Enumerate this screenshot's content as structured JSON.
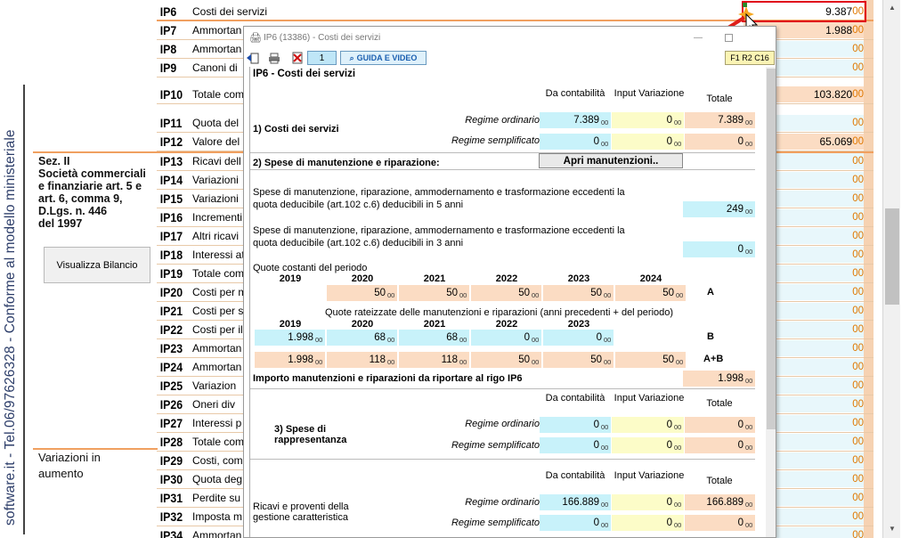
{
  "left_panel": {
    "vertical_text": "software.it - Tel.06/97626328 - Conforme al modello ministeriale",
    "sez_lines": [
      "Sez. II",
      "Società commerciali",
      "e finanziarie art. 5 e",
      "art. 6, comma 9,",
      "D.Lgs. n. 446",
      "del 1997"
    ],
    "visualizza_button": "Visualizza Bilancio",
    "variazioni_lines": [
      "Variazioni in",
      "aumento"
    ]
  },
  "rows": [
    {
      "code": "IP6",
      "desc": "Costi dei servizi",
      "value": "9.387",
      "dec": "00"
    },
    {
      "code": "IP7",
      "desc": "Ammortan",
      "value": "1.988",
      "dec": "00"
    },
    {
      "code": "IP8",
      "desc": "Ammortan",
      "value": "",
      "dec": "00"
    },
    {
      "code": "IP9",
      "desc": "Canoni di",
      "value": "",
      "dec": "00"
    },
    {
      "code": "IP10",
      "desc": "Totale com",
      "value": "103.820",
      "dec": "00"
    },
    {
      "code": "IP11",
      "desc": "Quota del",
      "value": "",
      "dec": "00"
    },
    {
      "code": "IP12",
      "desc": "Valore del",
      "value": "65.069",
      "dec": "00"
    },
    {
      "code": "IP13",
      "desc": "Ricavi dell",
      "value": "",
      "dec": "00"
    },
    {
      "code": "IP14",
      "desc": "Variazioni",
      "value": "",
      "dec": "00"
    },
    {
      "code": "IP15",
      "desc": "Variazioni",
      "value": "",
      "dec": "00"
    },
    {
      "code": "IP16",
      "desc": "Incrementi",
      "value": "",
      "dec": "00"
    },
    {
      "code": "IP17",
      "desc": "Altri ricavi",
      "value": "",
      "dec": "00"
    },
    {
      "code": "IP18",
      "desc": "Interessi at",
      "value": "",
      "dec": "00"
    },
    {
      "code": "IP19",
      "desc": "Totale com",
      "value": "",
      "dec": "00"
    },
    {
      "code": "IP20",
      "desc": "Costi per m",
      "value": "",
      "dec": "00"
    },
    {
      "code": "IP21",
      "desc": "Costi per s",
      "value": "",
      "dec": "00"
    },
    {
      "code": "IP22",
      "desc": "Costi per il",
      "value": "",
      "dec": "00"
    },
    {
      "code": "IP23",
      "desc": "Ammortan",
      "value": "",
      "dec": "00"
    },
    {
      "code": "IP24",
      "desc": "Ammortan",
      "value": "",
      "dec": "00"
    },
    {
      "code": "IP25",
      "desc": "Variazion",
      "value": "",
      "dec": "00"
    },
    {
      "code": "IP26",
      "desc": "Oneri div",
      "value": "",
      "dec": "00"
    },
    {
      "code": "IP27",
      "desc": "Interessi p",
      "value": "",
      "dec": "00"
    },
    {
      "code": "IP28",
      "desc": "Totale com",
      "value": "",
      "dec": "00"
    },
    {
      "code": "IP29",
      "desc": "Costi, com",
      "value": "",
      "dec": "00"
    },
    {
      "code": "IP30",
      "desc": "Quota deg",
      "value": "",
      "dec": "00"
    },
    {
      "code": "IP31",
      "desc": "Perdite su c",
      "value": "",
      "dec": "00"
    },
    {
      "code": "IP32",
      "desc": "Imposta m",
      "value": "",
      "dec": "00"
    },
    {
      "code": "IP34",
      "desc": "Ammortan",
      "value": "",
      "dec": "00"
    }
  ],
  "dialog": {
    "title": "IP6 (13386) - Costi dei servizi",
    "page_number": "1",
    "guide_button": "GUIDA E VIDEO",
    "ref": "F1 R2 C16",
    "heading": "IP6 - Costi dei servizi",
    "col_headers": {
      "da": "Da contabilità",
      "input": "Input Variazione",
      "totale": "Totale"
    },
    "section1": {
      "label": "1) Costi dei servizi",
      "regime_ordinario": "Regime ordinario",
      "regime_semplificato": "Regime semplificato",
      "ord": {
        "da": "7.389",
        "input": "0",
        "totale": "7.389"
      },
      "sempl": {
        "da": "0",
        "input": "0",
        "totale": "0"
      }
    },
    "section2": {
      "label": "2) Spese di manutenzione e riparazione:",
      "button": "Apri manutenzioni..",
      "text5_1": "Spese di manutenzione, riparazione, ammodernamento e trasformazione eccedenti la",
      "text5_2": "quota deducibile (art.102 c.6) deducibili in 5 anni",
      "val5": "249",
      "text3_1": "Spese di manutenzione, riparazione, ammodernamento e trasformazione eccedenti la",
      "text3_2": "quota deducibile (art.102 c.6) deducibili in 3 anni",
      "val3": "0",
      "quote_costanti": "Quote costanti del periodo",
      "years_a": [
        "2019",
        "2020",
        "2021",
        "2022",
        "2023",
        "2024"
      ],
      "values_a": [
        "50",
        "50",
        "50",
        "50",
        "50"
      ],
      "label_a": "A",
      "quote_rateizzate": "Quote rateizzate delle manutenzioni e riparazioni (anni precedenti + del periodo)",
      "years_b": [
        "2019",
        "2020",
        "2021",
        "2022",
        "2023"
      ],
      "values_b": [
        "1.998",
        "68",
        "68",
        "0",
        "0"
      ],
      "label_b": "B",
      "values_ab": [
        "1.998",
        "118",
        "118",
        "50",
        "50",
        "50"
      ],
      "label_ab": "A+B",
      "importo_label": "Importo manutenzioni e riparazioni da riportare al rigo IP6",
      "importo_value": "1.998"
    },
    "section3": {
      "label_1": "3) Spese di",
      "label_2": "rappresentanza",
      "ord": {
        "da": "0",
        "input": "0",
        "totale": "0"
      },
      "sempl": {
        "da": "0",
        "input": "0",
        "totale": "0"
      }
    },
    "section4": {
      "label_1": "Ricavi e proventi della",
      "label_2": "gestione caratteristica",
      "ord": {
        "da": "166.889",
        "input": "0",
        "totale": "166.889"
      },
      "sempl": {
        "da": "0",
        "input": "0",
        "totale": "0"
      }
    },
    "dec": "00"
  }
}
